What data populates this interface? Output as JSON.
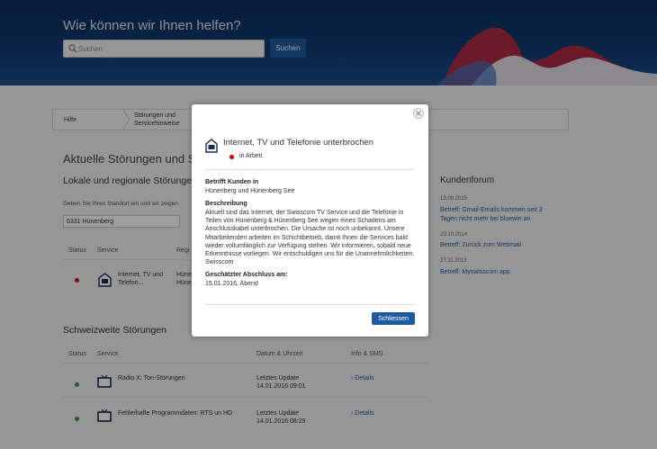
{
  "header": {
    "title": "Wie können wir Ihnen helfen?",
    "search_placeholder": "Suchen",
    "search_button": "Suchen"
  },
  "breadcrumb": [
    "Hilfe",
    "Störungen und Servicehinweise"
  ],
  "main": {
    "page_title": "Aktuelle Störungen und Se",
    "local_heading": "Lokale und regionale Störunge",
    "location_help": "Geben Sie Ihren Standort ein und wir zeigen",
    "location_value": "6331 Hünenberg",
    "local_columns": [
      "Status",
      "Service",
      "Regi"
    ],
    "local_rows": [
      {
        "service": "Internet, TV und Telefon...",
        "region": "Hüne\nHüne",
        "status": "red"
      }
    ],
    "nationwide_heading": "Schweizweite Störungen",
    "nationwide_columns": [
      "Status",
      "Service",
      "Datum & Uhrzeit",
      "Info & SMS"
    ],
    "nationwide_rows": [
      {
        "service": "Radio X: Ton-Störungen",
        "date_label": "Letztes Update",
        "date": "14.01.2016 09:01",
        "link": "› Details",
        "status": "green"
      },
      {
        "service": "Fehlerhafte Programmdaten: RTS un HD",
        "date_label": "Letztes Update",
        "date": "14.01.2016 08:29",
        "link": "› Details",
        "status": "green"
      }
    ]
  },
  "forum": {
    "title": "Kundenforum",
    "items": [
      {
        "date": "13.08.2015",
        "text": "Betreff: Gmail-Emails kommen seit 3 Tagen nicht mehr bei bluewin an"
      },
      {
        "date": "23.10.2014",
        "text": "Betreff: Zurück zum Webmail"
      },
      {
        "date": "27.11.2013",
        "text": "Betreff: Myswisscom app"
      }
    ]
  },
  "modal": {
    "title": "Internet, TV und Telefonie unterbrochen",
    "status": "in Arbeit",
    "affected_label": "Betrifft Kunden in",
    "affected_value": "Hünenberg und Hünenberg See",
    "description_label": "Beschreibung",
    "description": "Aktuell sind das Internet, der Swisscom TV Service und die Telefonie in Teilen von Hünenberg & Hünenberg See wegen eines Schadens am Anschlusskabel unterbrochen. Die Ursache ist noch unbekannt. Unsere Mitarbeitenden arbeiten im Schichtbetrieb, damit Ihnen die Services bald wieder vollumfänglich zur Verfügung stehen. Wir informieren, sobald neue Erkenntnisse vorliegen. Wir entschuldigen uns für die Unannehmlichkeiten. Swisscom",
    "end_label": "Geschätzter Abschluss am:",
    "end_value": "15.01.2016, Abend",
    "close_button": "Schliessen"
  },
  "colors": {
    "accent": "#1e5aa0",
    "status_in_progress": "#d0021b",
    "status_ok": "#2e9c3a"
  }
}
